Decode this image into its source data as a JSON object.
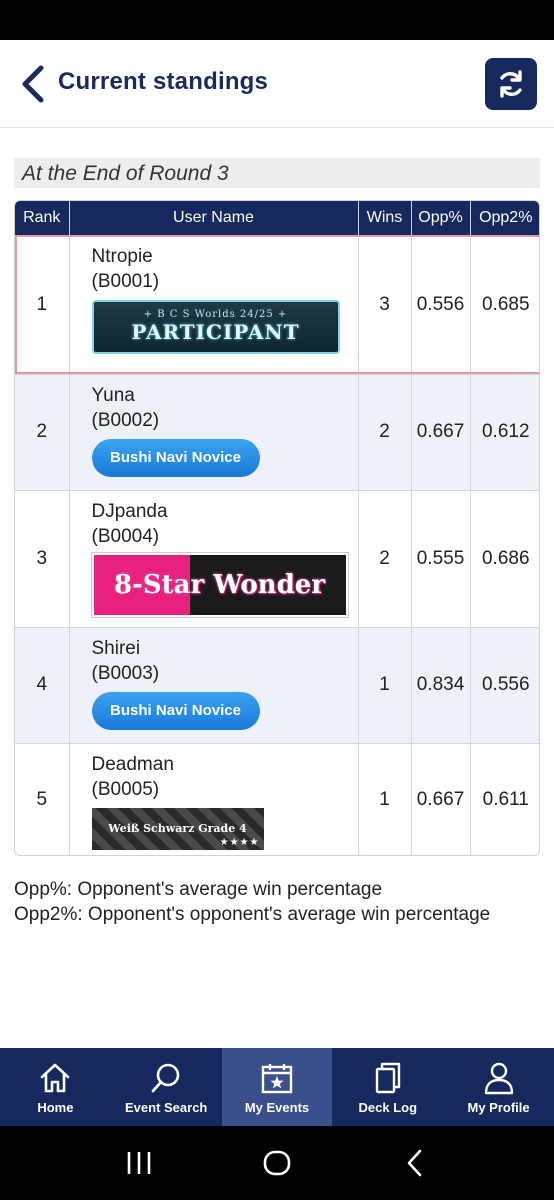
{
  "header": {
    "title": "Current standings"
  },
  "round_heading": "At the End of Round 3",
  "table": {
    "columns": [
      "Rank",
      "User Name",
      "Wins",
      "Opp%",
      "Opp2%"
    ],
    "rows": [
      {
        "rank": "1",
        "name": "Ntropie",
        "code": "(B0001)",
        "badge": "participant",
        "wins": "3",
        "opp": "0.556",
        "opp2": "0.685"
      },
      {
        "rank": "2",
        "name": "Yuna",
        "code": "(B0002)",
        "badge": "novice",
        "wins": "2",
        "opp": "0.667",
        "opp2": "0.612"
      },
      {
        "rank": "3",
        "name": "DJpanda",
        "code": "(B0004)",
        "badge": "wonder",
        "wins": "2",
        "opp": "0.555",
        "opp2": "0.686"
      },
      {
        "rank": "4",
        "name": "Shirei",
        "code": "(B0003)",
        "badge": "novice",
        "wins": "1",
        "opp": "0.834",
        "opp2": "0.556"
      },
      {
        "rank": "5",
        "name": "Deadman",
        "code": "(B0005)",
        "badge": "grade",
        "wins": "1",
        "opp": "0.667",
        "opp2": "0.611"
      }
    ]
  },
  "badges": {
    "participant_sub": "+ B C S Worlds 24/25 +",
    "participant_main": "PARTICIPANT",
    "novice": "Bushi Navi Novice",
    "wonder": "8-Star Wonder",
    "grade": "Weiß Schwarz Grade 4",
    "grade_stars": "★★★★"
  },
  "legend": {
    "opp": "Opp%: Opponent's average win percentage",
    "opp2": "Opp2%: Opponent's opponent's average win percentage"
  },
  "nav": [
    {
      "label": "Home",
      "icon": "home-icon"
    },
    {
      "label": "Event Search",
      "icon": "search-icon"
    },
    {
      "label": "My Events",
      "icon": "calendar-star-icon",
      "active": true
    },
    {
      "label": "Deck Log",
      "icon": "cards-icon"
    },
    {
      "label": "My Profile",
      "icon": "user-icon"
    }
  ],
  "colors": {
    "navy": "#15295e",
    "active_nav": "#3b4f8c",
    "highlight_border": "#e49aa2"
  }
}
